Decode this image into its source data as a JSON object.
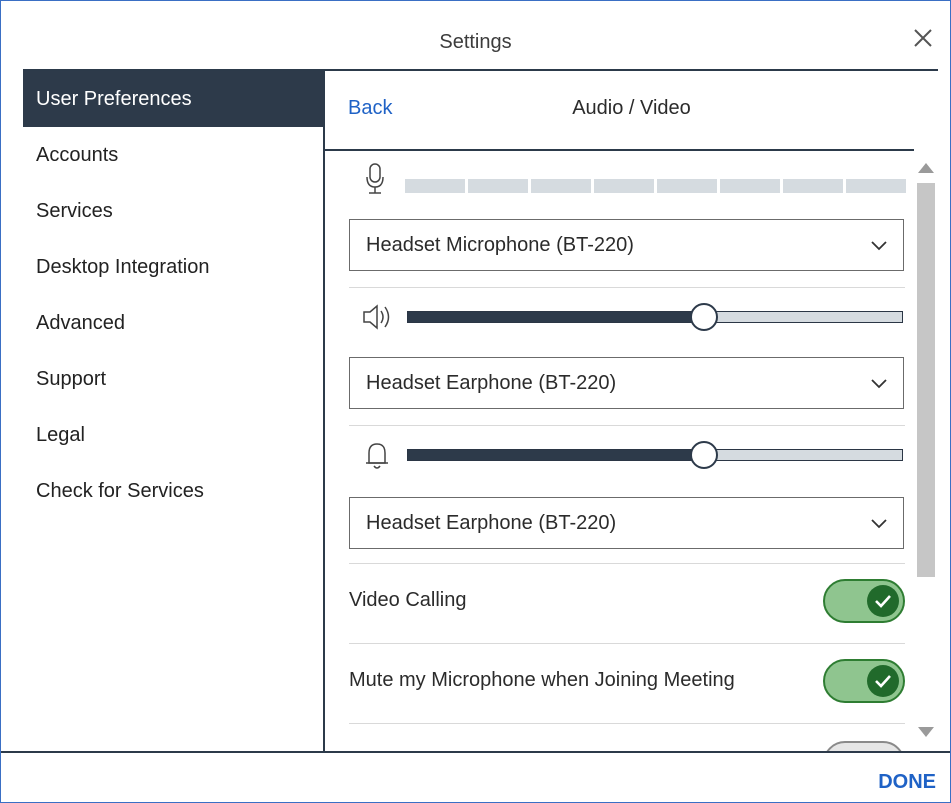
{
  "window": {
    "title": "Settings"
  },
  "sidebar": {
    "items": [
      {
        "label": "User Preferences",
        "active": true
      },
      {
        "label": "Accounts"
      },
      {
        "label": "Services"
      },
      {
        "label": "Desktop Integration"
      },
      {
        "label": "Advanced"
      },
      {
        "label": "Support"
      },
      {
        "label": "Legal"
      },
      {
        "label": "Check for Services"
      }
    ]
  },
  "header": {
    "back_label": "Back",
    "title": "Audio / Video"
  },
  "audio": {
    "microphone": {
      "icon": "microphone-icon",
      "level_segments_lit": 0,
      "level_segments_total": 8,
      "device": "Headset Microphone (BT-220)"
    },
    "speaker": {
      "icon": "speaker-icon",
      "volume_fraction": 0.6,
      "device": "Headset Earphone (BT-220)"
    },
    "ringer": {
      "icon": "bell-icon",
      "volume_fraction": 0.6,
      "device": "Headset Earphone (BT-220)"
    }
  },
  "toggles": {
    "video_calling": {
      "label": "Video Calling",
      "on": true
    },
    "mute_on_join": {
      "label": "Mute my Microphone when Joining Meeting",
      "on": true
    }
  },
  "footer": {
    "done_label": "DONE"
  },
  "colors": {
    "accent": "#1f62c6",
    "nav_active": "#2d3a4a",
    "toggle_on": "#216a2b"
  }
}
